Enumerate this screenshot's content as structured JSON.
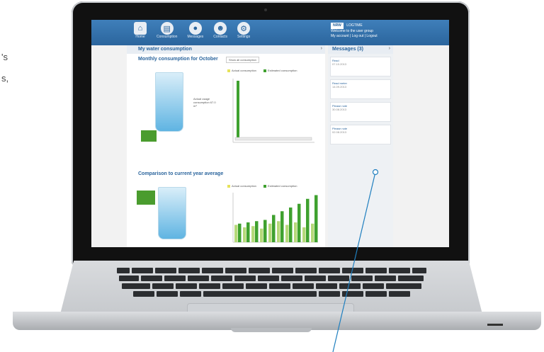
{
  "side_text": {
    "line1": "'s",
    "line2": "s,"
  },
  "app": {
    "nav": [
      {
        "label": "Home",
        "icon": "home-icon"
      },
      {
        "label": "Consumption",
        "icon": "document-icon"
      },
      {
        "label": "Messages",
        "icon": "chat-icon"
      },
      {
        "label": "Contacts",
        "icon": "contacts-icon"
      },
      {
        "label": "Settings",
        "icon": "gear-icon"
      }
    ],
    "user": {
      "logo": "NRW",
      "line1": "LOGTIME",
      "line2": "Welcome to the user group",
      "line3": "My account  |  Log out  |  Logout"
    },
    "main_title": "My water consumption",
    "monthly_title": "Monthly consumption for October",
    "monthly_select": "Show all consumption",
    "glass1_text": "Actual usage consumption 67.0 m³",
    "comparison_title": "Comparison to current year average",
    "legend_actual": "Actual consumption",
    "legend_estimated": "Estimated consumption",
    "side_panel_title": "Messages (3)",
    "messages": [
      {
        "title": "Read",
        "sub": "07.10.2013"
      },
      {
        "title": "Read meter",
        "sub": "14.09.2013"
      },
      {
        "title": "Please note",
        "sub": "30.08.2013"
      },
      {
        "title": "Please note",
        "sub": "02.08.2013"
      }
    ]
  },
  "chart_data": {
    "type": "bar",
    "series": [
      {
        "name": "Actual consumption",
        "values": [
          28,
          24,
          26,
          22,
          30,
          34,
          28,
          32,
          24,
          30
        ]
      },
      {
        "name": "Estimated consumption",
        "values": [
          30,
          32,
          34,
          36,
          44,
          50,
          56,
          62,
          70,
          76
        ]
      }
    ],
    "ylim": [
      0,
      80
    ]
  }
}
